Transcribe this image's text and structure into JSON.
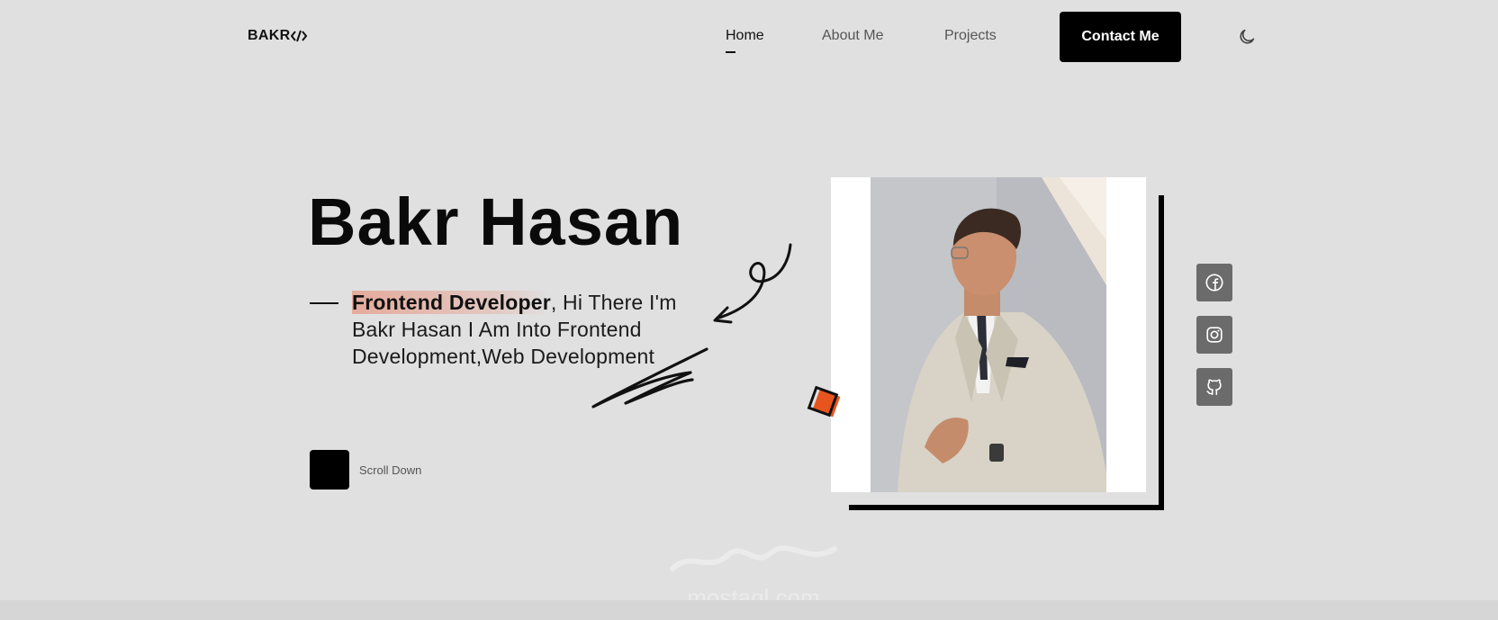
{
  "header": {
    "logo_text": "BAKR",
    "logo_icon": "code-brackets-icon",
    "nav": [
      {
        "label": "Home",
        "active": true
      },
      {
        "label": "About Me",
        "active": false
      },
      {
        "label": "Projects",
        "active": false
      }
    ],
    "contact_label": "Contact Me",
    "theme_icon": "moon-icon"
  },
  "hero": {
    "name": "Bakr Hasan",
    "role": "Frontend Developer",
    "tagline_rest": ", Hi There I'm Bakr Hasan I Am Into Frontend Development,Web Development",
    "scroll_label": "Scroll Down"
  },
  "social": [
    {
      "icon": "facebook-icon"
    },
    {
      "icon": "instagram-icon"
    },
    {
      "icon": "github-icon"
    }
  ],
  "watermark_text": "mostaql.com",
  "colors": {
    "background": "#e0e0e1",
    "accent": "#e8541e",
    "role_highlight": "#e79984",
    "social_bg": "#6b6b6b",
    "button_bg": "#000000"
  }
}
